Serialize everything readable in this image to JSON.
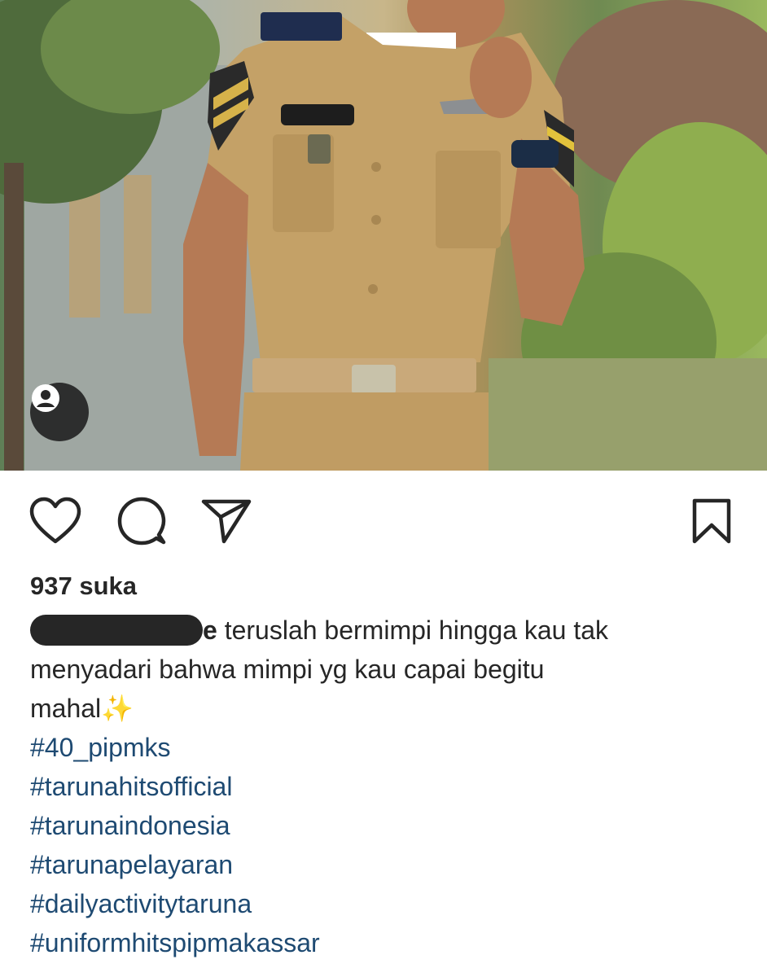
{
  "post": {
    "likes_text": "937 suka",
    "caption": {
      "username_tail": "e",
      "text_line1": " teruslah bermimpi hingga kau tak",
      "text_line2": "menyadari bahwa mimpi yg kau capai begitu",
      "text_line3": "mahal",
      "emoji": "✨"
    },
    "hashtags": [
      "#40_pipmks",
      "#tarunahitsofficial",
      "#tarunaindonesia",
      "#tarunapelayaran",
      "#dailyactivitytaruna",
      "#uniformhitspipmakassar"
    ]
  },
  "icons": {
    "like": "heart-icon",
    "comment": "comment-icon",
    "share": "send-icon",
    "save": "bookmark-icon",
    "tagged": "user-tag-icon"
  },
  "colors": {
    "text": "#262626",
    "hashtag": "#1e4a72",
    "background": "#ffffff"
  }
}
